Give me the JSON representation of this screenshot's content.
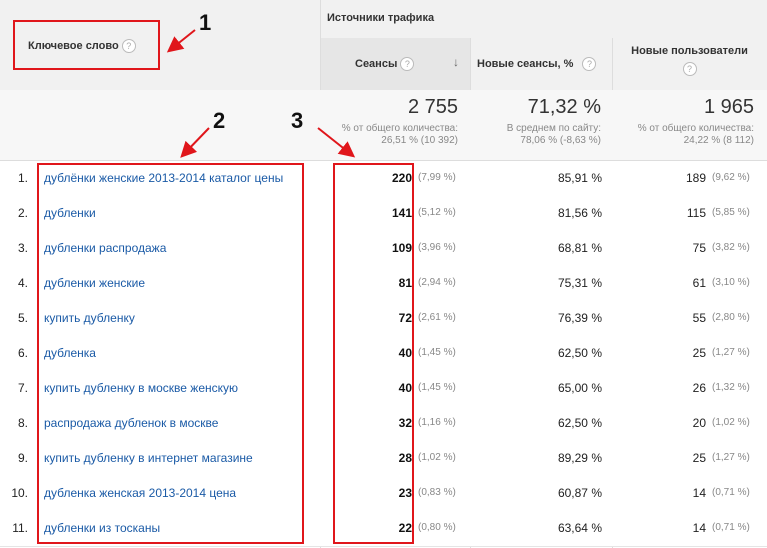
{
  "header": {
    "keyword_label": "Ключевое слово",
    "group_label": "Источники трафика",
    "help_glyph": "?",
    "sort_glyph": "↓",
    "columns": {
      "sessions": "Сеансы",
      "new_sessions": "Новые сеансы, %",
      "new_users": "Новые пользователи"
    }
  },
  "totals": {
    "sessions": {
      "value": "2 755",
      "line1": "% от общего количества:",
      "line2": "26,51 % (10 392)"
    },
    "new_sessions": {
      "value": "71,32 %",
      "line1": "В среднем по сайту:",
      "line2": "78,06 % (-8,63 %)"
    },
    "new_users": {
      "value": "1 965",
      "line1": "% от общего количества:",
      "line2": "24,22 % (8 112)"
    }
  },
  "rows": [
    {
      "idx": "1.",
      "keyword": "дублёнки женские 2013-2014 каталог цены",
      "sessions": "220",
      "sessions_pct": "(7,99 %)",
      "new_sessions": "85,91 %",
      "new_users": "189",
      "new_users_pct": "(9,62 %)"
    },
    {
      "idx": "2.",
      "keyword": "дубленки",
      "sessions": "141",
      "sessions_pct": "(5,12 %)",
      "new_sessions": "81,56 %",
      "new_users": "115",
      "new_users_pct": "(5,85 %)"
    },
    {
      "idx": "3.",
      "keyword": "дубленки распродажа",
      "sessions": "109",
      "sessions_pct": "(3,96 %)",
      "new_sessions": "68,81 %",
      "new_users": "75",
      "new_users_pct": "(3,82 %)"
    },
    {
      "idx": "4.",
      "keyword": "дубленки женские",
      "sessions": "81",
      "sessions_pct": "(2,94 %)",
      "new_sessions": "75,31 %",
      "new_users": "61",
      "new_users_pct": "(3,10 %)"
    },
    {
      "idx": "5.",
      "keyword": "купить дубленку",
      "sessions": "72",
      "sessions_pct": "(2,61 %)",
      "new_sessions": "76,39 %",
      "new_users": "55",
      "new_users_pct": "(2,80 %)"
    },
    {
      "idx": "6.",
      "keyword": "дубленка",
      "sessions": "40",
      "sessions_pct": "(1,45 %)",
      "new_sessions": "62,50 %",
      "new_users": "25",
      "new_users_pct": "(1,27 %)"
    },
    {
      "idx": "7.",
      "keyword": "купить дубленку в москве женскую",
      "sessions": "40",
      "sessions_pct": "(1,45 %)",
      "new_sessions": "65,00 %",
      "new_users": "26",
      "new_users_pct": "(1,32 %)"
    },
    {
      "idx": "8.",
      "keyword": "распродажа дубленок в москве",
      "sessions": "32",
      "sessions_pct": "(1,16 %)",
      "new_sessions": "62,50 %",
      "new_users": "20",
      "new_users_pct": "(1,02 %)"
    },
    {
      "idx": "9.",
      "keyword": "купить дубленку в интернет магазине",
      "sessions": "28",
      "sessions_pct": "(1,02 %)",
      "new_sessions": "89,29 %",
      "new_users": "25",
      "new_users_pct": "(1,27 %)"
    },
    {
      "idx": "10.",
      "keyword": "дубленка женская 2013-2014 цена",
      "sessions": "23",
      "sessions_pct": "(0,83 %)",
      "new_sessions": "60,87 %",
      "new_users": "14",
      "new_users_pct": "(0,71 %)"
    },
    {
      "idx": "11.",
      "keyword": "дубленки из тосканы",
      "sessions": "22",
      "sessions_pct": "(0,80 %)",
      "new_sessions": "63,64 %",
      "new_users": "14",
      "new_users_pct": "(0,71 %)"
    }
  ],
  "annotations": {
    "labels": [
      "1",
      "2",
      "3"
    ],
    "color": "#e0161b"
  }
}
